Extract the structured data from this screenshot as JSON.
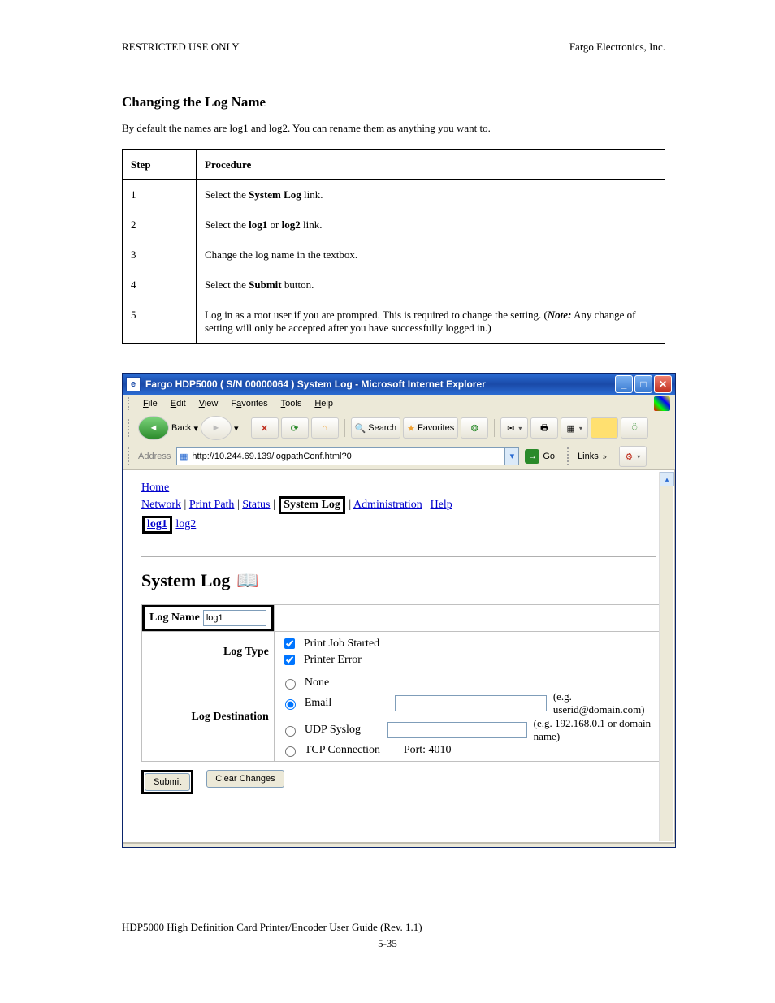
{
  "doc": {
    "section_label": "RESTRICTED USE ONLY",
    "product": "Fargo Electronics, Inc.",
    "page_title": "Changing the Log Name",
    "intro": "By default the names are log1 and log2. You can rename them as anything you want to.",
    "steps_header_step": "Step",
    "steps_header_proc": "Procedure",
    "steps": [
      {
        "n": "1",
        "p": "Select the System Log link."
      },
      {
        "n": "2",
        "p": "Select the log1 or log2 link."
      },
      {
        "n": "3",
        "p": "Change the log name in the textbox."
      },
      {
        "n": "4",
        "p": "Select the Submit button."
      },
      {
        "n": "5",
        "p_html": "Log in as a root user if you are prompted. This is required to change the setting. (<span class='italic'>Note:</span> Any change of setting will only be accepted after you have successfully logged in.)"
      }
    ],
    "footer_line1": "HDP5000 High Definition Card Printer/Encoder User Guide (Rev. 1.1)",
    "footer_line2": "5-35"
  },
  "browser": {
    "title": "Fargo HDP5000 ( S/N 00000064 ) System Log - Microsoft Internet Explorer",
    "menus": [
      "File",
      "Edit",
      "View",
      "Favorites",
      "Tools",
      "Help"
    ],
    "toolbar": {
      "back": "Back",
      "search": "Search",
      "favorites": "Favorites"
    },
    "address_label": "Address",
    "url": "http://10.244.69.139/logpathConf.html?0",
    "go": "Go",
    "links_label": "Links"
  },
  "page": {
    "home": "Home",
    "nav": [
      "Network",
      "Print Path",
      "Status",
      "System Log",
      "Administration",
      "Help"
    ],
    "sublinks": [
      "log1",
      "log2"
    ],
    "heading": "System Log",
    "form": {
      "log_name_label": "Log Name",
      "log_name_value": "log1",
      "log_type_label": "Log Type",
      "opt_print_started": "Print Job Started",
      "opt_printer_error": "Printer Error",
      "log_dest_label": "Log Destination",
      "dest_none": "None",
      "dest_email": "Email",
      "dest_udp": "UDP Syslog",
      "dest_tcp": "TCP Connection",
      "email_value": "",
      "email_hint": "(e.g. userid@domain.com)",
      "udp_value": "",
      "udp_hint": "(e.g. 192.168.0.1 or domain name)",
      "tcp_port_label": "Port: 4010",
      "submit": "Submit",
      "clear": "Clear Changes"
    }
  }
}
